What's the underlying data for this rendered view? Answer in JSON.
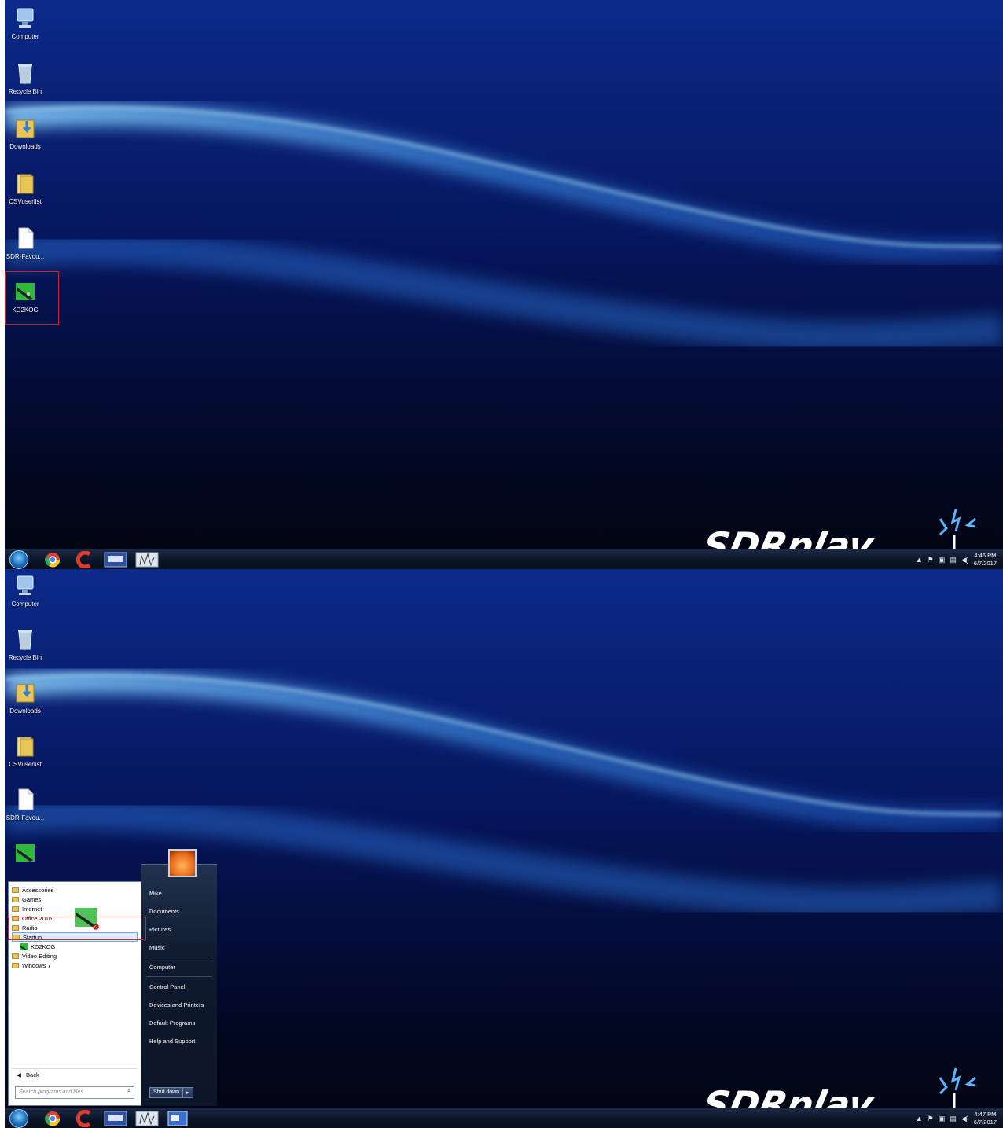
{
  "screens": [
    {
      "desktop_icons": [
        {
          "label": "Computer"
        },
        {
          "label": "Recycle Bin"
        },
        {
          "label": "Downloads"
        },
        {
          "label": "CSVuserlist"
        },
        {
          "label": "SDR-Favou..."
        },
        {
          "label": "KD2KOG"
        }
      ],
      "clock": {
        "time": "4:46 PM",
        "date": "6/7/2017"
      }
    },
    {
      "desktop_icons": [
        {
          "label": "Computer"
        },
        {
          "label": "Recycle Bin"
        },
        {
          "label": "Downloads"
        },
        {
          "label": "CSVuserlist"
        },
        {
          "label": "SDR-Favou..."
        }
      ],
      "clock": {
        "time": "4:47 PM",
        "date": "6/7/2017"
      },
      "start_menu": {
        "programs": [
          "Accessories",
          "Games",
          "Internet",
          "Office 2016",
          "Radio",
          "Startup",
          "KD2KOG",
          "Video Editing",
          "Windows 7"
        ],
        "right_items": [
          "Mike",
          "Documents",
          "Pictures",
          "Music",
          "Computer",
          "Control Panel",
          "Devices and Printers",
          "Default Programs",
          "Help and Support"
        ],
        "back_label": "Back",
        "search_placeholder": "Search programs and files",
        "shutdown_label": "Shut down",
        "shutdown_arrow": "▸"
      }
    }
  ],
  "wallpaper_brand": "SDRplay",
  "colors": {
    "highlight": "#c8262a",
    "wallpaper_base": "#000510",
    "wave": "#5ab4ff"
  }
}
